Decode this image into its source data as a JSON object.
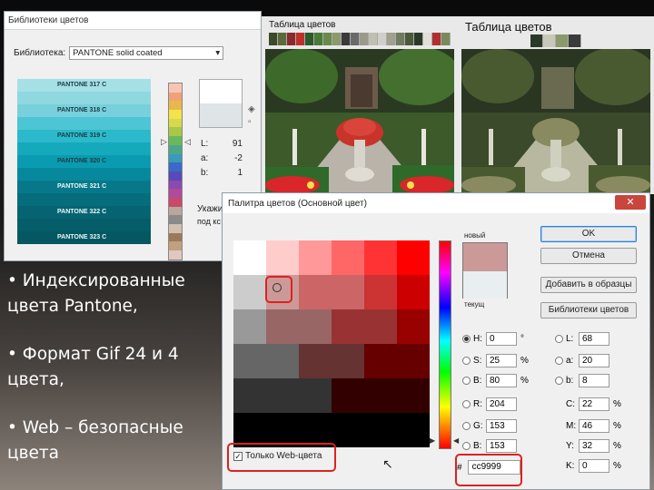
{
  "library_window": {
    "title": "Библиотеки цветов",
    "library_label": "Библиотека:",
    "library_value": "PANTONE solid coated",
    "dropdown_arrow": "▾",
    "swatches": [
      {
        "name": "PANTONE 317 C",
        "color": "#a6e0e7",
        "dark": false
      },
      {
        "name": "",
        "color": "#8fd8e0",
        "dark": false
      },
      {
        "name": "PANTONE 318 C",
        "color": "#77d0db",
        "dark": false
      },
      {
        "name": "",
        "color": "#4ec5d4",
        "dark": false
      },
      {
        "name": "PANTONE 319 C",
        "color": "#2bb9cb",
        "dark": false
      },
      {
        "name": "",
        "color": "#15a9bc",
        "dark": false
      },
      {
        "name": "PANTONE 320 C",
        "color": "#0a9bb0",
        "dark": false
      },
      {
        "name": "",
        "color": "#07899d",
        "dark": false
      },
      {
        "name": "PANTONE 321 C",
        "color": "#07788a",
        "dark": true
      },
      {
        "name": "",
        "color": "#066d7d",
        "dark": true
      },
      {
        "name": "PANTONE 322 C",
        "color": "#066472",
        "dark": true
      },
      {
        "name": "",
        "color": "#055d69",
        "dark": true
      },
      {
        "name": "PANTONE 323 C",
        "color": "#055862",
        "dark": true
      }
    ],
    "lab": {
      "l_label": "L:",
      "l_value": "91",
      "a_label": "a:",
      "a_value": "-2",
      "b_label": "b:",
      "b_value": "1"
    },
    "footer_line1": "Укажи",
    "footer_line2": "под кс"
  },
  "images": {
    "left_table_label": "Таблица цветов",
    "right_table_label": "Таблица цветов",
    "left_table_colors": [
      "#3a4a2a",
      "#5a6a3a",
      "#8a2a2a",
      "#c0302a",
      "#2a5a2a",
      "#4a7a3a",
      "#6a8a4a",
      "#8a9a6a",
      "#3a3a3a",
      "#6a6a6a",
      "#9a9a8a",
      "#c0c0b0",
      "#d0d0c8",
      "#a0a090",
      "#707a60",
      "#4a5a3a",
      "#2a3a2a",
      "#e0e0d8",
      "#b03030",
      "#7a8a5a"
    ],
    "right_table_colors": [
      "#2a3a2a",
      "#c8c8b8",
      "#8a9a6a",
      "#3a3a3a"
    ]
  },
  "bullets": [
    "• Индексированные цвета Pantone,",
    "• Формат Gif  24 и 4 цвета,",
    "• Web – безопасные цвета"
  ],
  "picker": {
    "title": "Палитра цветов (Основной цвет)",
    "close_glyph": "✕",
    "new_label": "новый",
    "current_label": "текущ",
    "new_color": "#cc9999",
    "current_color": "#e9eef0",
    "buttons": {
      "ok": "OK",
      "cancel": "Отмена",
      "add_swatch": "Добавить в образцы",
      "libraries": "Библиотеки цветов"
    },
    "hsb": {
      "h_label": "H:",
      "h_value": "0",
      "h_unit": "°",
      "s_label": "S:",
      "s_value": "25",
      "s_unit": "%",
      "b_label": "B:",
      "b_value": "80",
      "b_unit": "%"
    },
    "rgb": {
      "r_label": "R:",
      "r_value": "204",
      "g_label": "G:",
      "g_value": "153",
      "b_label": "B:",
      "b_value": "153"
    },
    "lab": {
      "l_label": "L:",
      "l_value": "68",
      "a_label": "a:",
      "a_value": "20",
      "b_label": "b:",
      "b_value": "8"
    },
    "cmyk": {
      "c_label": "C:",
      "c_value": "22",
      "c_unit": "%",
      "m_label": "M:",
      "m_value": "46",
      "m_unit": "%",
      "y_label": "Y:",
      "y_value": "32",
      "y_unit": "%",
      "k_label": "K:",
      "k_value": "0",
      "k_unit": "%"
    },
    "hex_label": "#",
    "hex_value": "cc9999",
    "web_only_label": "Только Web-цвета",
    "web_only_checked": "✓",
    "cursor_glyph": "↖"
  }
}
